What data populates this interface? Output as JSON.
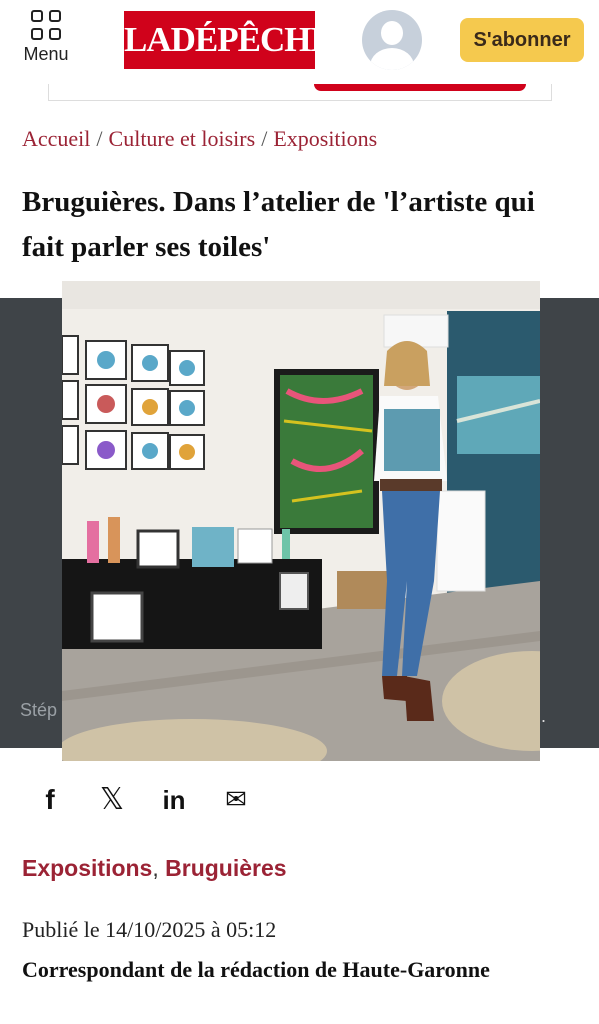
{
  "header": {
    "menu_label": "Menu",
    "logo_text": "LADÉPÊCHE",
    "subscribe_label": "S'abonner"
  },
  "breadcrumb": [
    "Accueil",
    "Culture et loisirs",
    "Expositions"
  ],
  "article": {
    "title": "Bruguières. Dans l’atelier de 'l’artiste qui fait parler ses toiles'",
    "photo_caption_left": "Stép",
    "photo_caption_right": ".",
    "tags": [
      "Expositions",
      "Bruguières"
    ],
    "published": "Publié le 14/10/2025 à 05:12",
    "author": "Correspondant de la rédaction de Haute-Garonne"
  },
  "share": {
    "facebook": "f",
    "x": "𝕏",
    "linkedin": "in",
    "email": "✉"
  },
  "colors": {
    "brand_red": "#d0021b",
    "link_red": "#9b2335",
    "subscribe_yellow": "#f5c94e"
  }
}
